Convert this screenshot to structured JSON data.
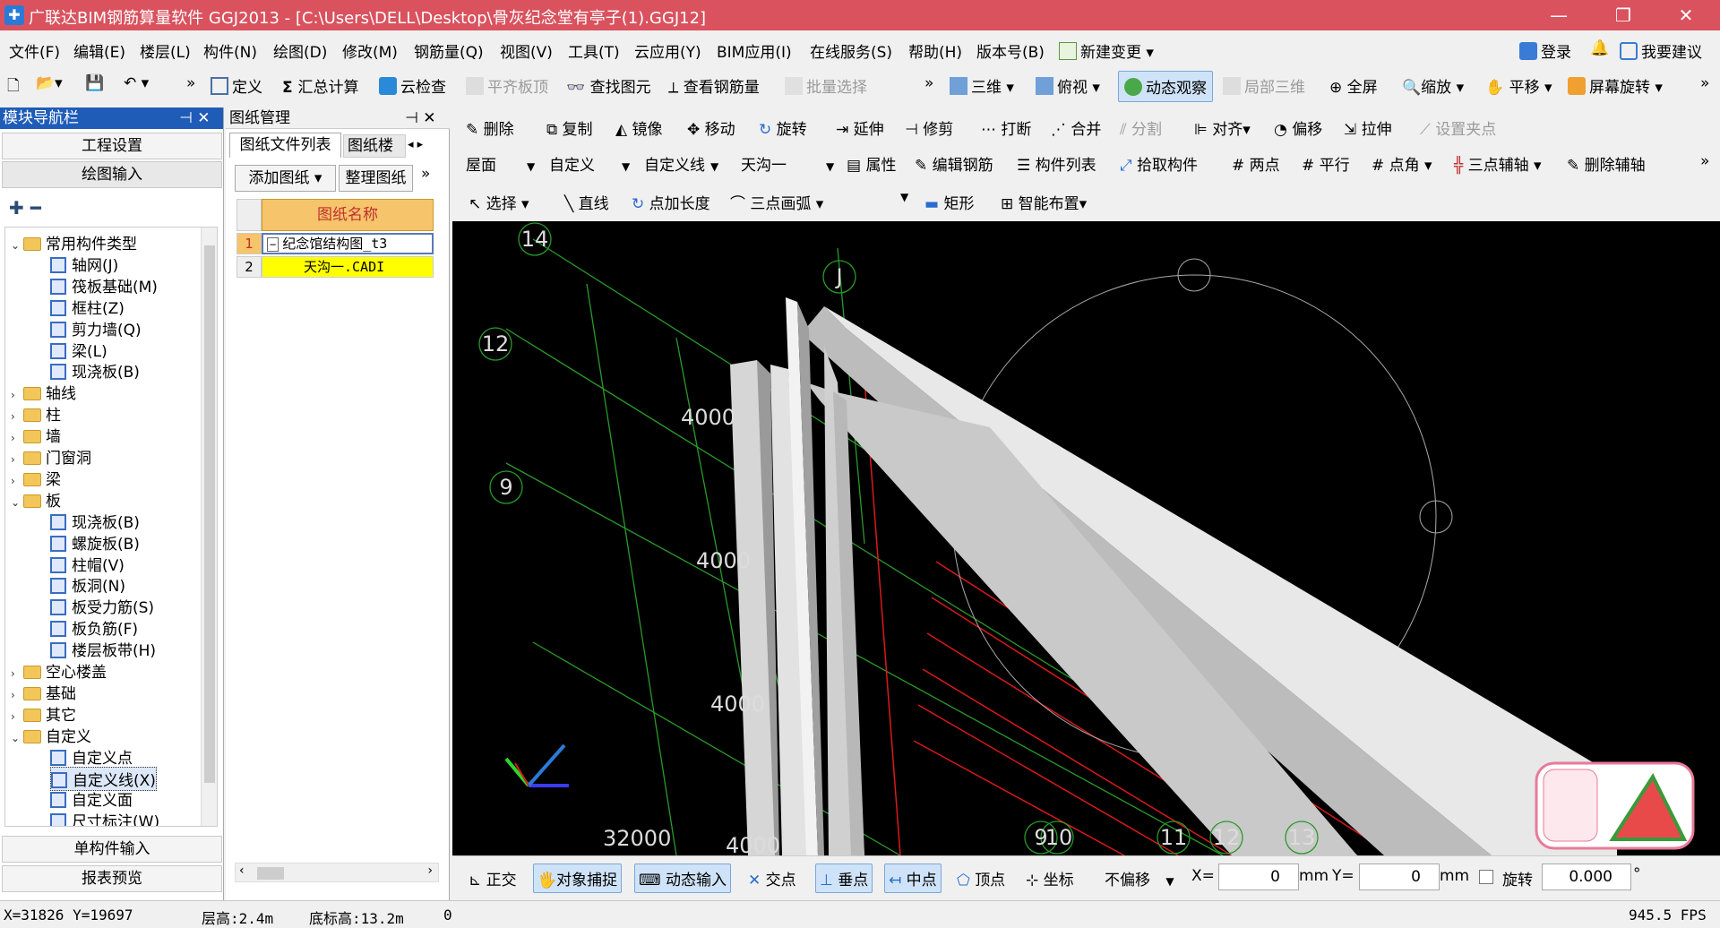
{
  "window": {
    "title": "广联达BIM钢筋算量软件 GGJ2013 - [C:\\Users\\DELL\\Desktop\\骨灰纪念堂有亭子(1).GGJ12]",
    "min": "—",
    "max": "❐",
    "close": "✕"
  },
  "menubar": [
    "文件(F)",
    "编辑(E)",
    "楼层(L)",
    "构件(N)",
    "绘图(D)",
    "修改(M)",
    "钢筋量(Q)",
    "视图(V)",
    "工具(T)",
    "云应用(Y)",
    "BIM应用(I)",
    "在线服务(S)",
    "帮助(H)",
    "版本号(B)",
    "新建变更"
  ],
  "menubar_right": {
    "login": "登录",
    "suggest": "我要建议"
  },
  "toolbar1": {
    "items": [
      "定义",
      "汇总计算",
      "云检查",
      "平齐板顶",
      "查找图元",
      "查看钢筋量",
      "批量选择"
    ],
    "right": [
      "三维",
      "俯视",
      "动态观察",
      "局部三维",
      "全屏",
      "缩放",
      "平移",
      "屏幕旋转"
    ],
    "overflow": "»"
  },
  "toolbar2": [
    "删除",
    "复制",
    "镜像",
    "移动",
    "旋转",
    "延伸",
    "修剪",
    "打断",
    "合并",
    "分割",
    "对齐",
    "偏移",
    "拉伸",
    "设置夹点"
  ],
  "toolbar3": {
    "floor": "屋面",
    "type": "自定义",
    "subtype": "自定义线",
    "component": "天沟一",
    "items": [
      "属性",
      "编辑钢筋",
      "构件列表",
      "拾取构件",
      "两点",
      "平行",
      "点角",
      "三点辅轴",
      "删除辅轴"
    ]
  },
  "toolbar4": [
    "选择",
    "直线",
    "点加长度",
    "三点画弧",
    "矩形",
    "智能布置"
  ],
  "nav": {
    "title": "模块导航栏",
    "pin": "⊣ ✕",
    "engineering": "工程设置",
    "drawing": "绘图输入",
    "single": "单构件输入",
    "report": "报表预览",
    "tree": [
      {
        "label": "常用构件类型",
        "level": 0,
        "type": "folder",
        "exp": "v"
      },
      {
        "label": "轴网(J)",
        "level": 1,
        "type": "item"
      },
      {
        "label": "筏板基础(M)",
        "level": 1,
        "type": "item"
      },
      {
        "label": "框柱(Z)",
        "level": 1,
        "type": "item"
      },
      {
        "label": "剪力墙(Q)",
        "level": 1,
        "type": "item"
      },
      {
        "label": "梁(L)",
        "level": 1,
        "type": "item"
      },
      {
        "label": "现浇板(B)",
        "level": 1,
        "type": "item"
      },
      {
        "label": "轴线",
        "level": 0,
        "type": "folder",
        "exp": ">"
      },
      {
        "label": "柱",
        "level": 0,
        "type": "folder",
        "exp": ">"
      },
      {
        "label": "墙",
        "level": 0,
        "type": "folder",
        "exp": ">"
      },
      {
        "label": "门窗洞",
        "level": 0,
        "type": "folder",
        "exp": ">"
      },
      {
        "label": "梁",
        "level": 0,
        "type": "folder",
        "exp": ">"
      },
      {
        "label": "板",
        "level": 0,
        "type": "folder",
        "exp": "v"
      },
      {
        "label": "现浇板(B)",
        "level": 1,
        "type": "item"
      },
      {
        "label": "螺旋板(B)",
        "level": 1,
        "type": "item"
      },
      {
        "label": "柱帽(V)",
        "level": 1,
        "type": "item"
      },
      {
        "label": "板洞(N)",
        "level": 1,
        "type": "item"
      },
      {
        "label": "板受力筋(S)",
        "level": 1,
        "type": "item"
      },
      {
        "label": "板负筋(F)",
        "level": 1,
        "type": "item"
      },
      {
        "label": "楼层板带(H)",
        "level": 1,
        "type": "item"
      },
      {
        "label": "空心楼盖",
        "level": 0,
        "type": "folder",
        "exp": ">"
      },
      {
        "label": "基础",
        "level": 0,
        "type": "folder",
        "exp": ">"
      },
      {
        "label": "其它",
        "level": 0,
        "type": "folder",
        "exp": ">"
      },
      {
        "label": "自定义",
        "level": 0,
        "type": "folder",
        "exp": "v"
      },
      {
        "label": "自定义点",
        "level": 1,
        "type": "item"
      },
      {
        "label": "自定义线(X)",
        "level": 1,
        "type": "item",
        "selected": true
      },
      {
        "label": "自定义面",
        "level": 1,
        "type": "item"
      },
      {
        "label": "尺寸标注(W)",
        "level": 1,
        "type": "item"
      }
    ]
  },
  "drawings": {
    "title": "图纸管理",
    "tab1": "图纸文件列表",
    "tab2": "图纸楼",
    "add": "添加图纸",
    "organize": "整理图纸",
    "col": "图纸名称",
    "rows": [
      {
        "n": "1",
        "name": "纪念馆结构图_t3"
      },
      {
        "n": "2",
        "name": "天沟一.CADI"
      }
    ]
  },
  "canvas": {
    "axis_labels": [
      "14",
      "J",
      "12",
      "9",
      "9",
      "10",
      "11",
      "12",
      "13"
    ],
    "dims": [
      "4000",
      "4000",
      "4000",
      "32000",
      "4000"
    ]
  },
  "snapbar": {
    "items": [
      "正交",
      "对象捕捉",
      "动态输入",
      "交点",
      "垂点",
      "中点",
      "顶点",
      "坐标"
    ],
    "offset": "不偏移",
    "x_label": "X=",
    "x_val": "0",
    "mm1": "mm",
    "y_label": "Y=",
    "y_val": "0",
    "mm2": "mm",
    "rotate": "旋转",
    "rot_val": "0.000",
    "deg": "°"
  },
  "status": {
    "coords": "X=31826 Y=19697",
    "floor_h": "层高:2.4m",
    "base_h": "底标高:13.2m",
    "zero": "0",
    "fps": "945.5 FPS"
  }
}
